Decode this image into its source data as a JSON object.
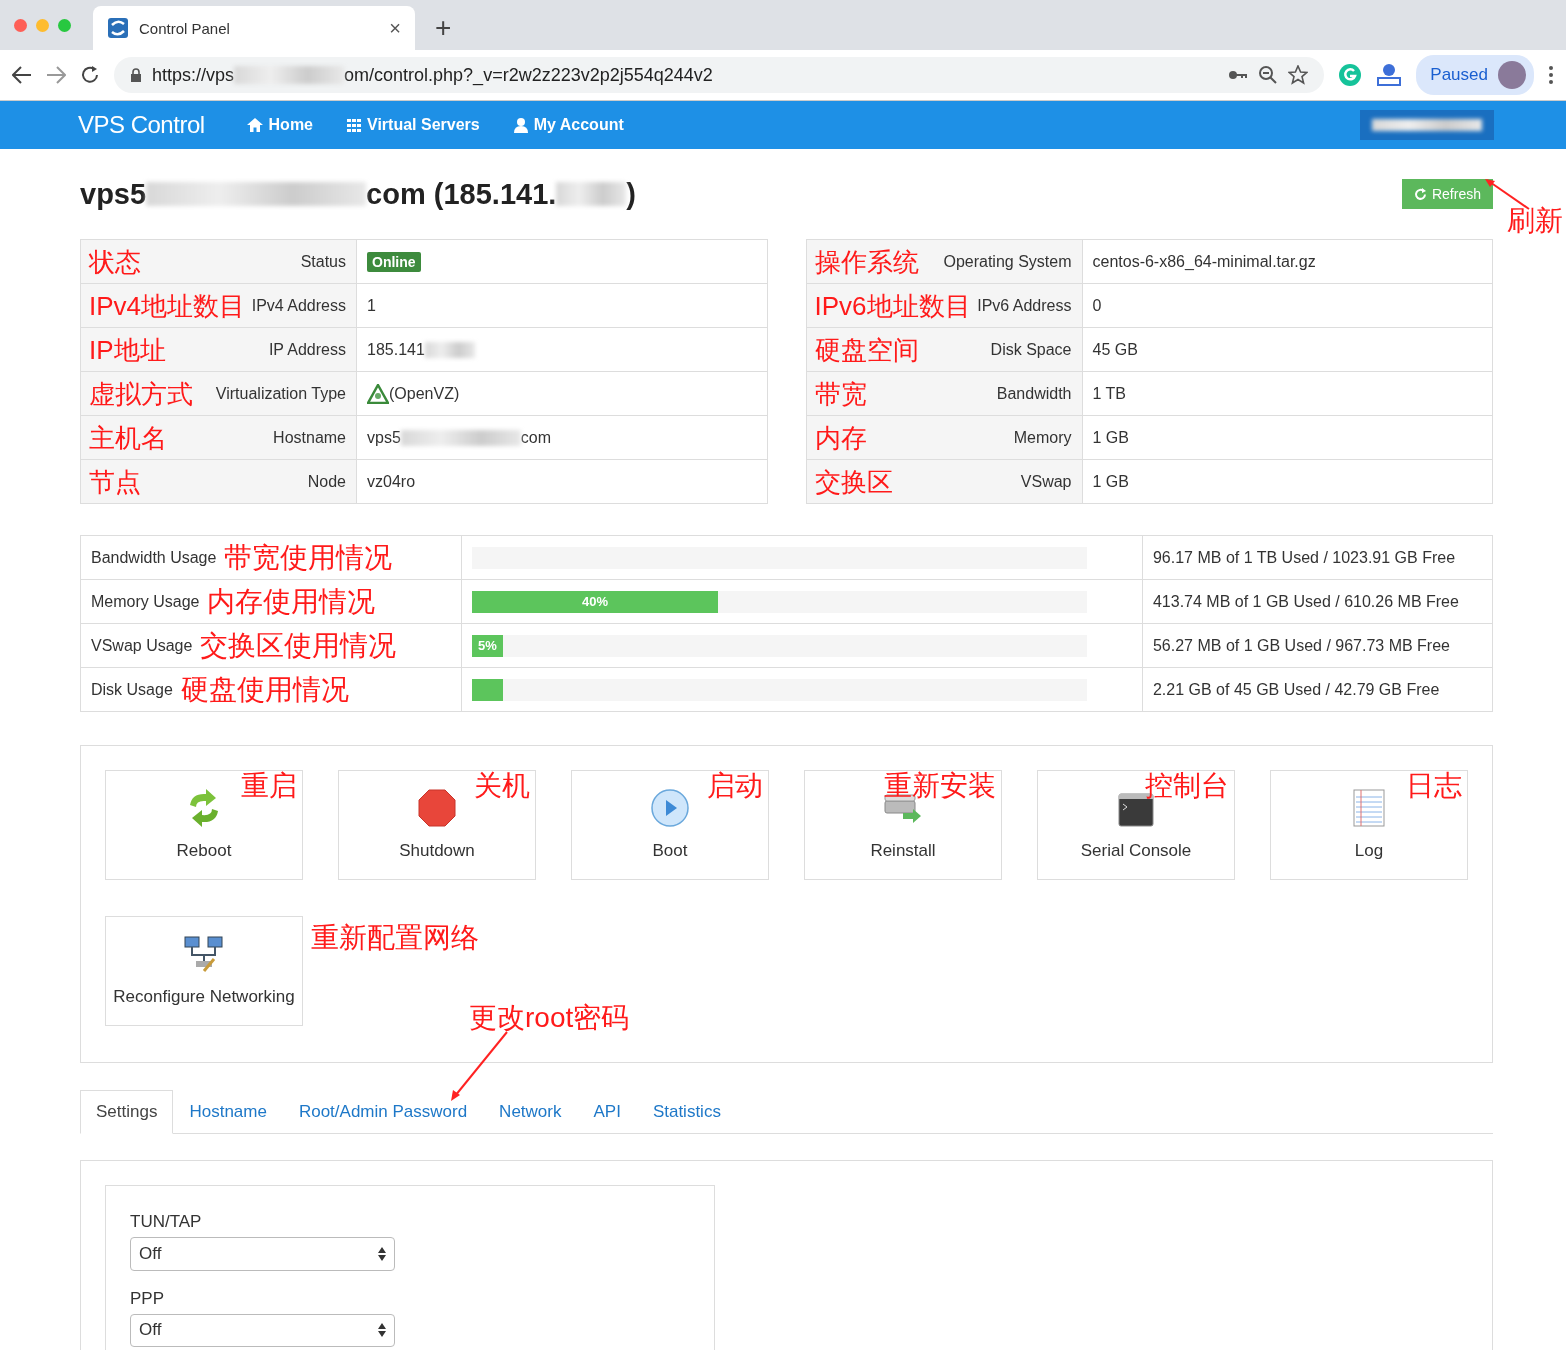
{
  "browser": {
    "tab_title": "Control Panel",
    "tab_close": "×",
    "new_tab": "+",
    "url_start": "https://vps",
    "url_end": "om/control.php?_v=r2w2z223v2p2j554q244v2",
    "profile_label": "Paused"
  },
  "navbar": {
    "brand": "VPS Control",
    "items": [
      {
        "label": "Home",
        "kind": "home"
      },
      {
        "label": "Virtual Servers",
        "kind": "grid"
      },
      {
        "label": "My Account",
        "kind": "user"
      }
    ]
  },
  "server": {
    "title_start": "vps5",
    "title_mid": "com (185.141.",
    "title_end": ")",
    "refresh": "Refresh",
    "refresh_note": "刷新"
  },
  "info_left": [
    {
      "label": "Status",
      "note": "状态",
      "kind": "badge",
      "value": "Online"
    },
    {
      "label": "IPv4 Address",
      "note": "IPv4地址数目",
      "kind": "text",
      "value": "1"
    },
    {
      "label": "IP Address",
      "note": "IP地址",
      "kind": "blurred",
      "value": "185.141"
    },
    {
      "label": "Virtualization Type",
      "note": "虚拟方式",
      "kind": "icon_text",
      "value": "(OpenVZ)"
    },
    {
      "label": "Hostname",
      "note": "主机名",
      "kind": "blurred",
      "value": "vps5",
      "value_suffix": "com"
    },
    {
      "label": "Node",
      "note": "节点",
      "kind": "text",
      "value": "vz04ro"
    }
  ],
  "info_right": [
    {
      "label": "Operating System",
      "note": "操作系统",
      "kind": "text",
      "value": "centos-6-x86_64-minimal.tar.gz"
    },
    {
      "label": "IPv6 Address",
      "note": "IPv6地址数目",
      "kind": "text",
      "value": "0"
    },
    {
      "label": "Disk Space",
      "note": "硬盘空间",
      "kind": "text",
      "value": "45 GB"
    },
    {
      "label": "Bandwidth",
      "note": "带宽",
      "kind": "text",
      "value": "1 TB"
    },
    {
      "label": "Memory",
      "note": "内存",
      "kind": "text",
      "value": "1 GB"
    },
    {
      "label": "VSwap",
      "note": "交换区",
      "kind": "text",
      "value": "1 GB"
    }
  ],
  "usage": [
    {
      "label": "Bandwidth Usage",
      "note": "带宽使用情况",
      "level": 0.0001,
      "reading": "96.17 MB of 1 TB Used / 1023.91 GB Free"
    },
    {
      "label": "Memory Usage",
      "note": "内存使用情况",
      "level": 0.4,
      "bar_label": "40%",
      "reading": "413.74 MB of 1 GB Used / 610.26 MB Free"
    },
    {
      "label": "VSwap Usage",
      "note": "交换区使用情况",
      "level": 0.05,
      "bar_label": "5%",
      "reading": "56.27 MB of 1 GB Used / 967.73 MB Free"
    },
    {
      "label": "Disk Usage",
      "note": "硬盘使用情况",
      "level": 0.05,
      "reading": "2.21 GB of 45 GB Used / 42.79 GB Free"
    }
  ],
  "actions": [
    {
      "label": "Reboot",
      "note": "重启"
    },
    {
      "label": "Shutdown",
      "note": "关机"
    },
    {
      "label": "Boot",
      "note": "启动"
    },
    {
      "label": "Reinstall",
      "note": "重新安装"
    },
    {
      "label": "Serial Console",
      "note": "控制台"
    },
    {
      "label": "Log",
      "note": "日志"
    },
    {
      "label": "Reconfigure Networking",
      "note": "重新配置网络"
    }
  ],
  "password_note": "更改root密码",
  "tabs": [
    {
      "label": "Settings",
      "selected": true
    },
    {
      "label": "Hostname",
      "selected": false
    },
    {
      "label": "Root/Admin Password",
      "selected": false
    },
    {
      "label": "Network",
      "selected": false
    },
    {
      "label": "API",
      "selected": false
    },
    {
      "label": "Statistics",
      "selected": false
    }
  ],
  "settings": [
    {
      "label": "TUN/TAP",
      "value": "Off"
    },
    {
      "label": "PPP",
      "value": "Off"
    }
  ]
}
